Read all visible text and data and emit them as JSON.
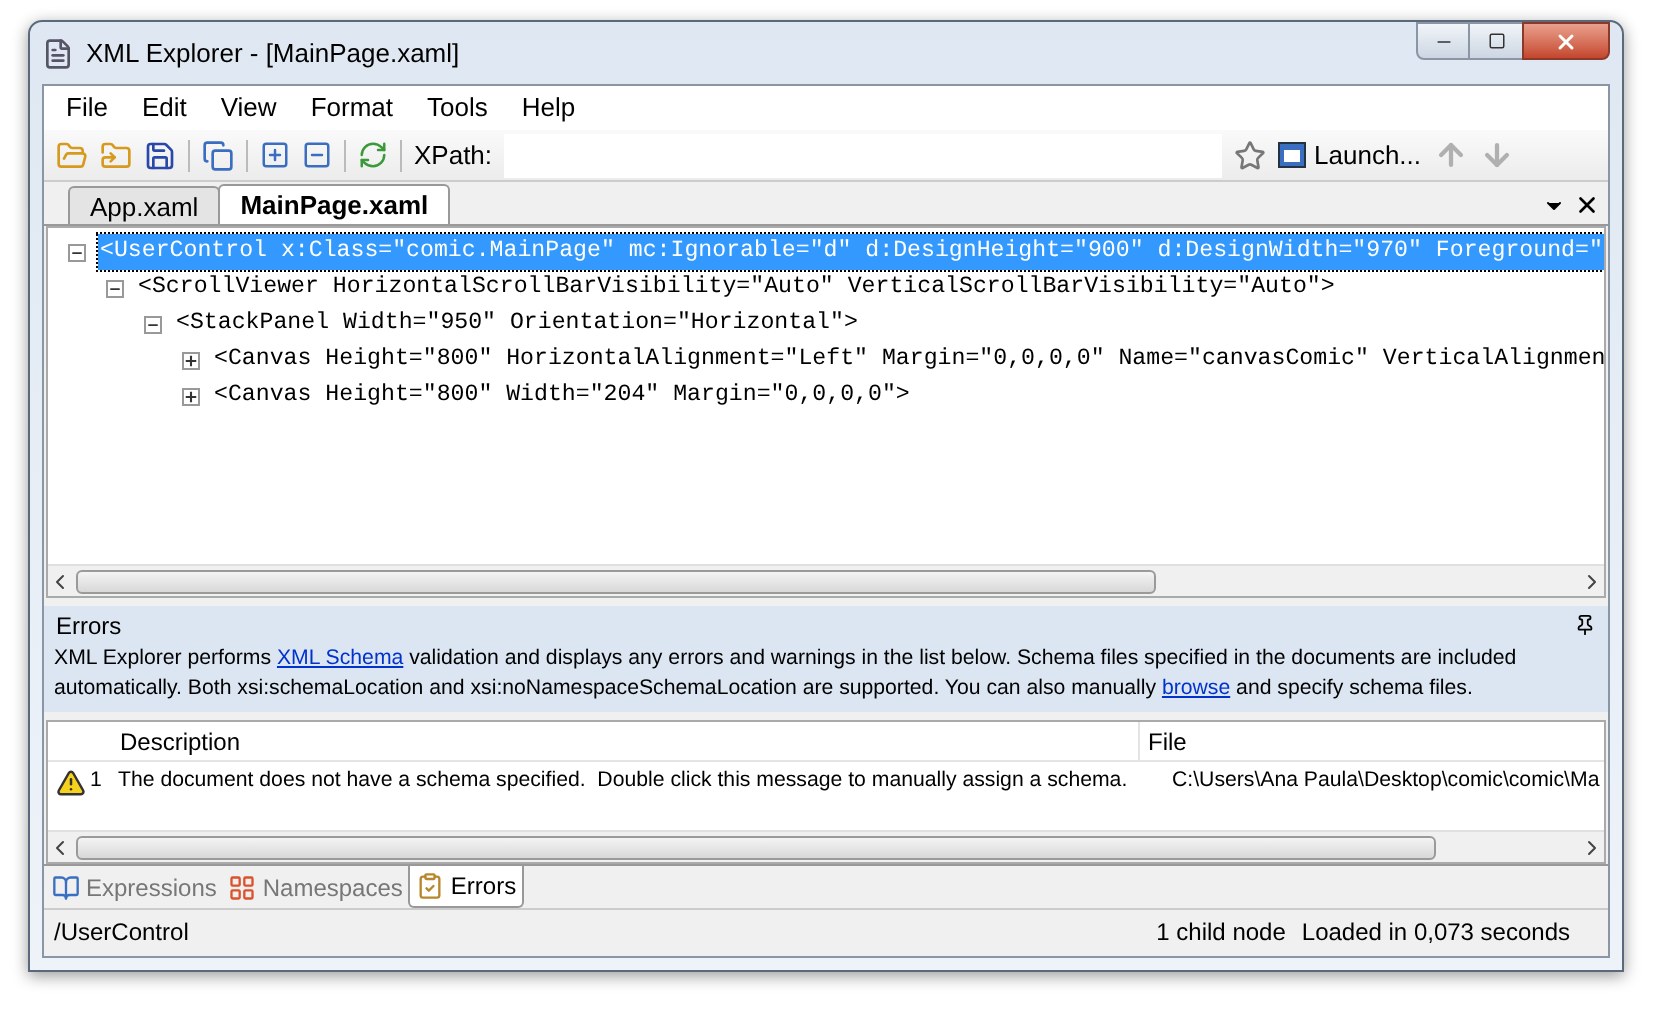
{
  "window": {
    "title": "XML Explorer - [MainPage.xaml]"
  },
  "menu": [
    "File",
    "Edit",
    "View",
    "Format",
    "Tools",
    "Help"
  ],
  "toolbar": {
    "xpath_label": "XPath:",
    "launch_label": "Launch..."
  },
  "doc_tabs": [
    {
      "label": "App.xaml",
      "selected": false
    },
    {
      "label": "MainPage.xaml",
      "selected": true
    }
  ],
  "tree": [
    {
      "text": "<UserControl x:Class=\"comic.MainPage\" mc:Ignorable=\"d\" d:DesignHeight=\"900\" d:DesignWidth=\"970\" Foreground=\"",
      "expanded": true,
      "selected": true,
      "children": [
        {
          "text": "<ScrollViewer HorizontalScrollBarVisibility=\"Auto\" VerticalScrollBarVisibility=\"Auto\">",
          "expanded": true,
          "selected": false,
          "children": [
            {
              "text": "<StackPanel Width=\"950\" Orientation=\"Horizontal\">",
              "expanded": true,
              "selected": false,
              "children": [
                {
                  "text": "<Canvas Height=\"800\" HorizontalAlignment=\"Left\" Margin=\"0,0,0,0\" Name=\"canvasComic\" VerticalAlignmen",
                  "expanded": false,
                  "selected": false
                },
                {
                  "text": "<Canvas Height=\"800\" Width=\"204\" Margin=\"0,0,0,0\">",
                  "expanded": false,
                  "selected": false
                }
              ]
            }
          ]
        }
      ]
    }
  ],
  "errors_panel": {
    "title": "Errors",
    "info_parts": [
      {
        "kind": "text",
        "text": "XML Explorer performs "
      },
      {
        "kind": "link",
        "text": "XML Schema"
      },
      {
        "kind": "text",
        "text": " validation and displays any errors and warnings in the list below. Schema files specified in the documents are included automatically. Both xsi:schemaLocation and xsi:noNamespaceSchemaLocation are supported. You can also manually "
      },
      {
        "kind": "link",
        "text": "browse"
      },
      {
        "kind": "text",
        "text": " and specify schema files."
      }
    ],
    "columns": [
      "Description",
      "File"
    ],
    "rows": [
      {
        "number": "1",
        "description": "The document does not have a schema specified.  Double click this message to manually assign a schema.",
        "file": "C:\\Users\\Ana Paula\\Desktop\\comic\\comic\\Ma"
      }
    ]
  },
  "bottom_tabs": [
    {
      "label": "Expressions",
      "kind": "expressions",
      "selected": false
    },
    {
      "label": "Namespaces",
      "kind": "namespaces",
      "selected": false
    },
    {
      "label": "Errors",
      "kind": "errors",
      "selected": true
    }
  ],
  "status_bar": {
    "path": "/UserControl",
    "child_count": "1 child node",
    "load_time": "Loaded in 0,073 seconds"
  }
}
